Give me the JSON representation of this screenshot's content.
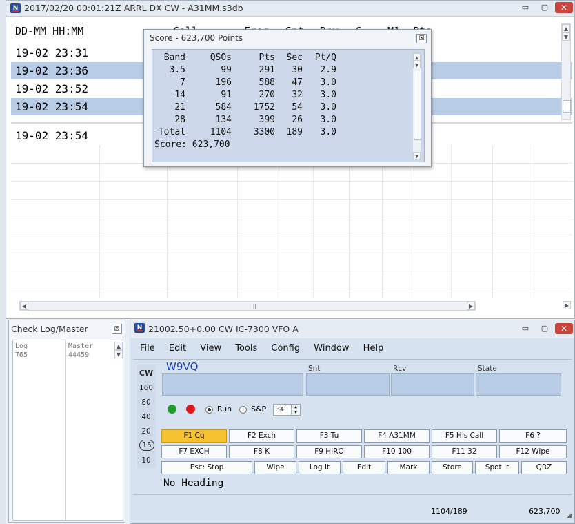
{
  "log_window": {
    "title": "2017/02/20 00:01:21Z  ARRL DX CW - A31MM.s3db",
    "minimize": "▭",
    "maximize": "▢",
    "close": "✕",
    "headers": [
      "DD-MM HH:MM",
      "Call",
      "Freq",
      "Snt",
      "Rcv",
      "S",
      "M1",
      "Pts"
    ],
    "rows": [
      {
        "time": "19-02 23:31",
        "selected": false
      },
      {
        "time": "19-02 23:36",
        "selected": true
      },
      {
        "time": "19-02 23:52",
        "selected": false
      },
      {
        "time": "19-02 23:54",
        "selected": true
      }
    ],
    "lower_row": "19-02 23:54"
  },
  "score_window": {
    "title": "Score - 623,700 Points",
    "close": "☒",
    "columns": [
      "Band",
      "QSOs",
      "Pts",
      "Sec",
      "Pt/Q"
    ],
    "rows": [
      [
        "3.5",
        "99",
        "291",
        "30",
        "2.9"
      ],
      [
        "7",
        "196",
        "588",
        "47",
        "3.0"
      ],
      [
        "14",
        "91",
        "270",
        "32",
        "3.0"
      ],
      [
        "21",
        "584",
        "1752",
        "54",
        "3.0"
      ],
      [
        "28",
        "134",
        "399",
        "26",
        "3.0"
      ],
      [
        "Total",
        "1104",
        "3300",
        "189",
        "3.0"
      ]
    ],
    "score_line": "Score: 623,700"
  },
  "check_window": {
    "title": "Check Log/Master",
    "close": "☒",
    "log_label": "Log",
    "log_value": "765",
    "master_label": "Master",
    "master_value": "44459"
  },
  "entry_window": {
    "title": "21002.50+0.00 CW IC-7300 VFO A",
    "minimize": "▭",
    "maximize": "▢",
    "close": "✕",
    "menu": [
      "File",
      "Edit",
      "View",
      "Tools",
      "Config",
      "Window",
      "Help"
    ],
    "mode": "CW",
    "bands": [
      "160",
      "80",
      "40",
      "20",
      "15",
      "10"
    ],
    "active_band": "15",
    "call_value": "W9VQ",
    "snt_label": "Snt",
    "rcv_label": "Rcv",
    "state_label": "State",
    "run_label": "Run",
    "sp_label": "S&P",
    "speed": "34",
    "fkeys_row1": [
      "F1 Cq",
      "F2 Exch",
      "F3 Tu",
      "F4 A31MM",
      "F5 His Call",
      "F6 ?"
    ],
    "fkeys_row2": [
      "F7 EXCH",
      "F8 K",
      "F9 HIRO",
      "F10 100",
      "F11 32",
      "F12 Wipe"
    ],
    "buttons_row3": [
      "Esc: Stop",
      "Wipe",
      "Log It",
      "Edit",
      "Mark",
      "Store",
      "Spot It",
      "QRZ"
    ],
    "heading": "No Heading",
    "status_count": "1104/189",
    "status_score": "623,700"
  },
  "colors": {
    "selection": "#b9cce6",
    "active_fkey": "#f6c231",
    "call_text": "#1a3fc4",
    "green_dot": "#1f9a2a",
    "red_dot": "#e01515"
  }
}
